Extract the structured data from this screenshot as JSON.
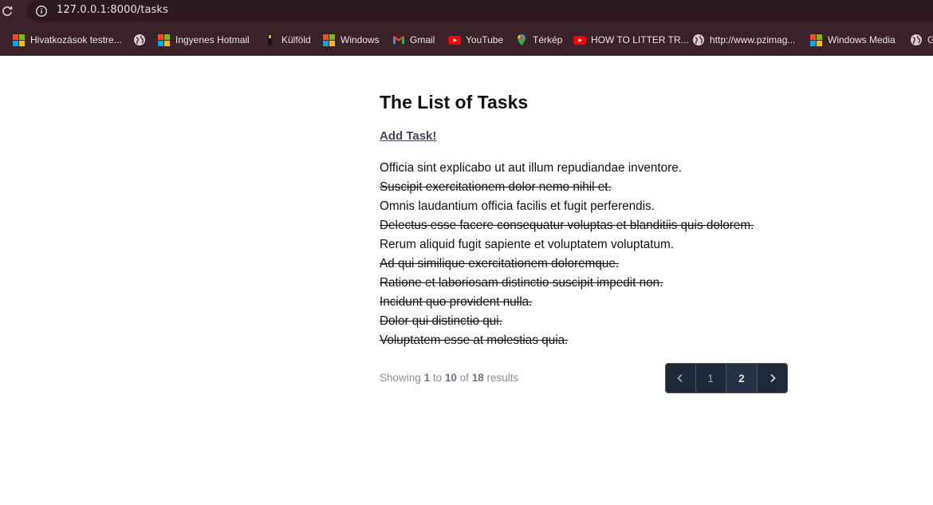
{
  "browser": {
    "url": "127.0.0.1:8000/tasks",
    "bookmarks": [
      {
        "label": "Hivatkozások testre...",
        "icon": "microsoft-icon"
      },
      {
        "label": "",
        "icon": "globe-icon"
      },
      {
        "label": "Ingyenes Hotmail",
        "icon": "microsoft-icon"
      },
      {
        "label": "Külföld",
        "icon": "bookmark-file-icon"
      },
      {
        "label": "Windows",
        "icon": "microsoft-icon"
      },
      {
        "label": "Gmail",
        "icon": "gmail-icon"
      },
      {
        "label": "YouTube",
        "icon": "youtube-icon"
      },
      {
        "label": "Térkép",
        "icon": "maps-pin-icon"
      },
      {
        "label": "HOW TO LITTER TR...",
        "icon": "youtube-icon"
      },
      {
        "label": "http://www.pzimag...",
        "icon": "globe-icon"
      },
      {
        "label": "Windows Media",
        "icon": "microsoft-icon"
      },
      {
        "label": "G",
        "icon": "globe-icon"
      }
    ]
  },
  "page": {
    "title": "The List of Tasks",
    "add_task_label": "Add Task!",
    "tasks": [
      {
        "text": "Officia sint explicabo ut aut illum repudiandae inventore.",
        "done": false
      },
      {
        "text": "Suscipit exercitationem dolor nemo nihil et.",
        "done": true
      },
      {
        "text": "Omnis laudantium officia facilis et fugit perferendis.",
        "done": false
      },
      {
        "text": "Delectus esse facere consequatur voluptas et blanditiis quis dolorem.",
        "done": true
      },
      {
        "text": "Rerum aliquid fugit sapiente et voluptatem voluptatum.",
        "done": false
      },
      {
        "text": "Ad qui similique exercitationem doloremque.",
        "done": true
      },
      {
        "text": "Ratione et laboriosam distinctio suscipit impedit non.",
        "done": true
      },
      {
        "text": "Incidunt quo provident nulla.",
        "done": true
      },
      {
        "text": "Dolor qui distinctio qui.",
        "done": true
      },
      {
        "text": "Voluptatem esse at molestias quia.",
        "done": true
      }
    ],
    "pagination": {
      "showing_prefix": "Showing",
      "from": "1",
      "to_word": "to",
      "to": "10",
      "of_word": "of",
      "total": "18",
      "results_word": "results",
      "prev_icon": "chevron-left-icon",
      "next_icon": "chevron-right-icon",
      "pages": [
        "1",
        "2"
      ],
      "current_page": "2"
    }
  },
  "colors": {
    "chrome_bg": "#3a2328",
    "pagination_bg": "#1f2937"
  }
}
